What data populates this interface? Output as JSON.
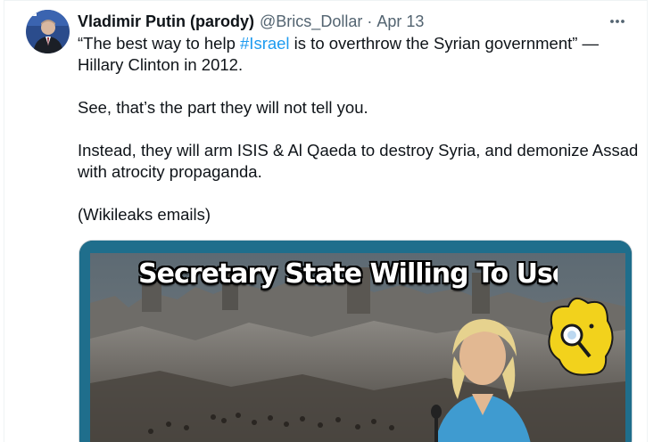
{
  "author": {
    "display_name": "Vladimir Putin (parody)",
    "handle": "@Brics_Dollar",
    "separator": "·",
    "date": "Apr 13"
  },
  "tweet": {
    "line1_prefix": "“The best way to help ",
    "hashtag": "#Israel",
    "line1_suffix": " is to overthrow the Syrian government” — Hillary Clinton in 2012.",
    "para2": "See, that’s the part they will not tell you.",
    "para3": "Instead, they will arm ISIS & Al Qaeda to destroy Syria, and demonize Assad with atrocity propaganda.",
    "para4": "(Wikileaks emails)"
  },
  "media": {
    "caption": "Secretary State Willing To Use"
  },
  "icons": {
    "more": "more-horizontal-icon",
    "avatar": "avatar-image"
  },
  "colors": {
    "link": "#1d9bf0",
    "secondary_text": "#536471",
    "primary_text": "#0f1419",
    "border": "#eff3f4",
    "media_frame": "#1f6e8c"
  }
}
